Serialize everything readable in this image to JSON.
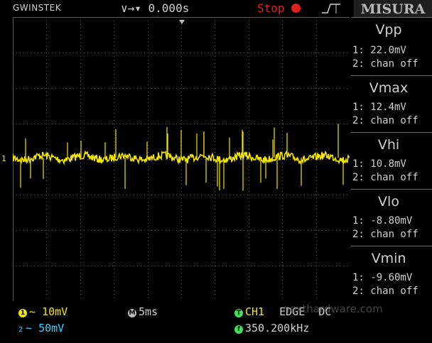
{
  "header": {
    "brand": "GWINSTEK",
    "trigger_position": "∨→▾ 0.000s",
    "run_state": "Stop",
    "panel_title": "MISURA"
  },
  "measurements": [
    {
      "name": "Vpp",
      "ch1": "1: 22.0mV",
      "ch2": "2: chan off"
    },
    {
      "name": "Vmax",
      "ch1": "1: 12.4mV",
      "ch2": "2: chan off"
    },
    {
      "name": "Vhi",
      "ch1": "1: 10.8mV",
      "ch2": "2: chan off"
    },
    {
      "name": "Vlo",
      "ch1": "1: -8.80mV",
      "ch2": "2: chan off"
    },
    {
      "name": "Vmin",
      "ch1": "1: -9.60mV",
      "ch2": "2: chan off"
    }
  ],
  "footer": {
    "ch1_scale": "∼ 10mV",
    "ch2_scale": "∼ 50mV",
    "timebase": "5ms",
    "trigger_source": "CH1",
    "trigger_type": "EDGE",
    "coupling": "DC",
    "frequency": "350.200kHz",
    "ch1_badge": "1",
    "ch2_badge": "2",
    "time_badge": "M",
    "trig_badge": "T",
    "freq_badge": "f",
    "watermark": "nexthardware.com"
  },
  "channel_marker": "1",
  "colors": {
    "ch1": "#f4e600",
    "ch2": "#3fd0ff",
    "trigger": "#3fe05a",
    "stop": "#e02020"
  }
}
